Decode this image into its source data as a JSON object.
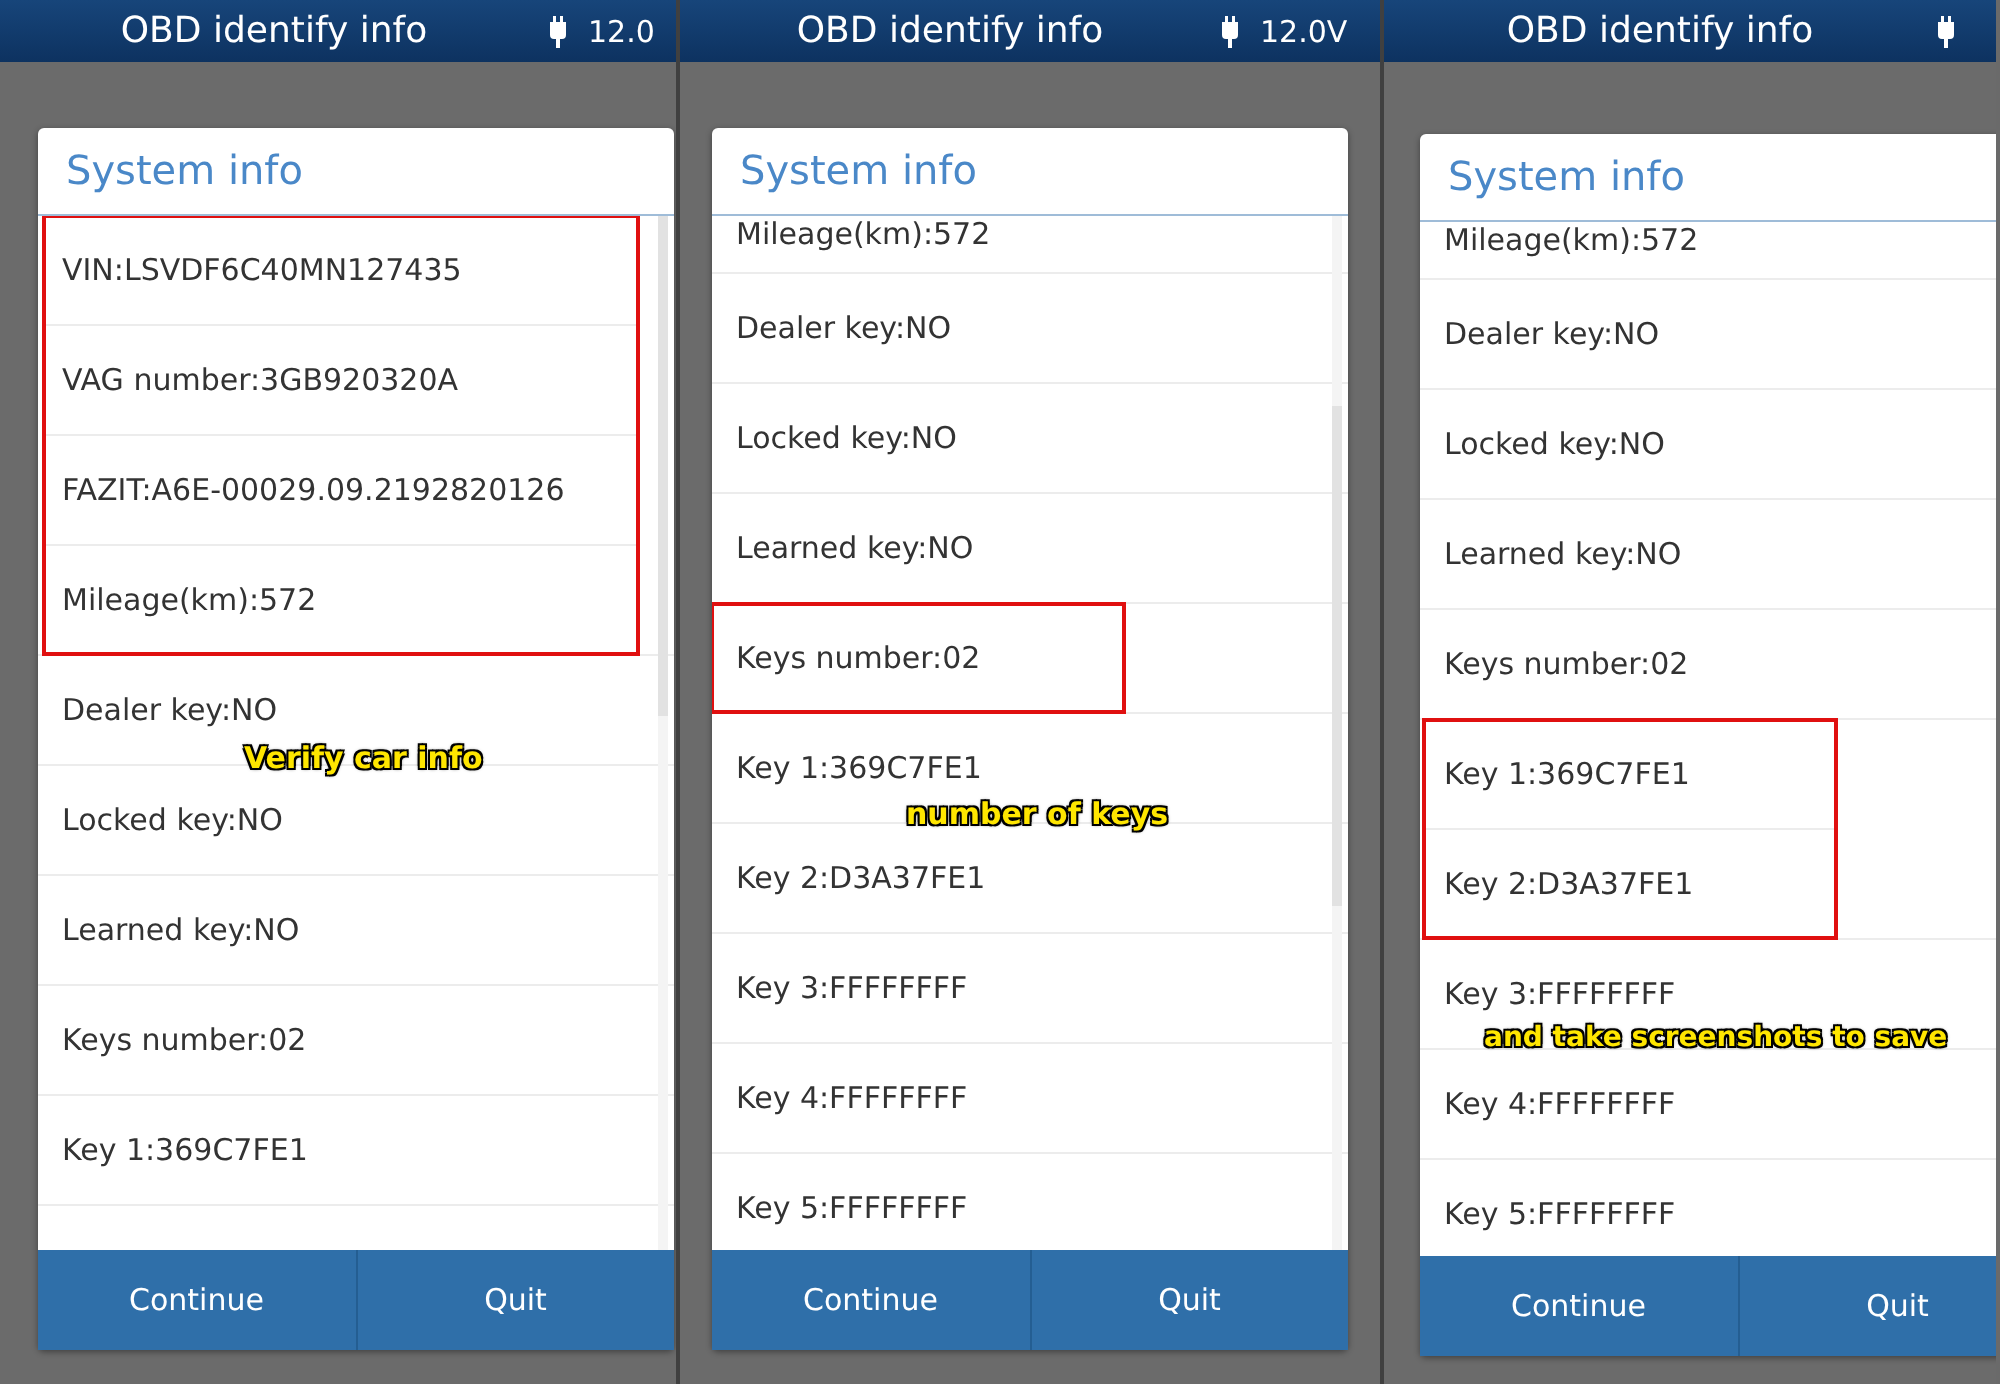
{
  "panels": [
    {
      "header": {
        "title": "OBD identify info",
        "voltage": "12.0"
      },
      "dialog": {
        "title": "System info",
        "rows": [
          {
            "kind": "highlight_group",
            "rows": [
              {
                "text": "VIN:LSVDF6C40MN127435",
                "kind": "full"
              },
              {
                "text": "VAG number:3GB920320A",
                "kind": "full"
              },
              {
                "text": "FAZIT:A6E-00029.09.2192820126",
                "kind": "full"
              },
              {
                "text": "Mileage(km):572",
                "kind": "full"
              }
            ]
          },
          {
            "text": "Dealer key:NO",
            "kind": "full"
          },
          {
            "text": "Locked key:NO",
            "kind": "full"
          },
          {
            "text": "Learned key:NO",
            "kind": "full"
          },
          {
            "text": "Keys number:02",
            "kind": "full"
          },
          {
            "text": "Key 1:369C7FE1",
            "kind": "full"
          }
        ],
        "buttons": [
          "Continue",
          "Quit"
        ]
      },
      "caption": "Verify car info"
    },
    {
      "header": {
        "title": "OBD identify info",
        "voltage": "12.0V"
      },
      "dialog": {
        "title": "System info",
        "rows": [
          {
            "text": "Mileage(km):572",
            "kind": "partial"
          },
          {
            "text": "Dealer key:NO",
            "kind": "full"
          },
          {
            "text": "Locked key:NO",
            "kind": "full"
          },
          {
            "text": "Learned key:NO",
            "kind": "full"
          },
          {
            "kind": "highlight_group",
            "rows": [
              {
                "text": "Keys number:02",
                "kind": "full"
              }
            ]
          },
          {
            "text": "Key 1:369C7FE1",
            "kind": "full"
          },
          {
            "text": "Key 2:D3A37FE1",
            "kind": "full"
          },
          {
            "text": "Key 3:FFFFFFFF",
            "kind": "full"
          },
          {
            "text": "Key 4:FFFFFFFF",
            "kind": "full"
          },
          {
            "text": "Key 5:FFFFFFFF",
            "kind": "full"
          }
        ],
        "buttons": [
          "Continue",
          "Quit"
        ]
      },
      "caption": "number of keys"
    },
    {
      "header": {
        "title": "OBD identify info"
      },
      "dialog": {
        "title": "System info",
        "rows": [
          {
            "text": "Mileage(km):572",
            "kind": "partial"
          },
          {
            "text": "Dealer key:NO",
            "kind": "full"
          },
          {
            "text": "Locked key:NO",
            "kind": "full"
          },
          {
            "text": "Learned key:NO",
            "kind": "full"
          },
          {
            "text": "Keys number:02",
            "kind": "full"
          },
          {
            "kind": "highlight_group",
            "rows": [
              {
                "text": "Key 1:369C7FE1",
                "kind": "full"
              },
              {
                "text": "Key 2:D3A37FE1",
                "kind": "full"
              }
            ]
          },
          {
            "text": "Key 3:FFFFFFFF",
            "kind": "full"
          },
          {
            "text": "Key 4:FFFFFFFF",
            "kind": "full"
          },
          {
            "text": "Key 5:FFFFFFFF",
            "kind": "full"
          }
        ],
        "buttons": [
          "Continue",
          "Quit"
        ]
      },
      "caption": "and take screenshots to save"
    }
  ]
}
